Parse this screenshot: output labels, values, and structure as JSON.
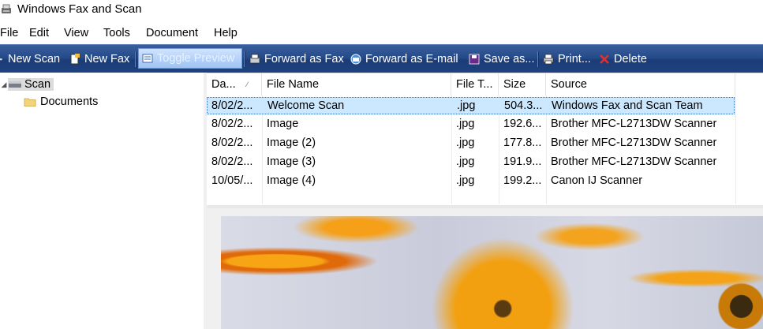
{
  "window": {
    "title": "Windows Fax and Scan"
  },
  "menu": [
    "File",
    "Edit",
    "View",
    "Tools",
    "Document",
    "Help"
  ],
  "toolbar": {
    "new_scan": "New Scan",
    "new_fax": "New Fax",
    "toggle_preview": "Toggle Preview",
    "forward_fax": "Forward as Fax",
    "forward_email": "Forward as E-mail",
    "save_as": "Save as...",
    "print": "Print...",
    "delete": "Delete"
  },
  "tree": {
    "root": "Scan",
    "child": "Documents"
  },
  "list": {
    "columns": [
      "Da...",
      "File Name",
      "File T...",
      "Size",
      "Source"
    ],
    "rows": [
      {
        "date": "8/02/2...",
        "name": "Welcome Scan",
        "type": ".jpg",
        "size": "504.3...",
        "source": "Windows Fax and Scan Team"
      },
      {
        "date": "8/02/2...",
        "name": "Image",
        "type": ".jpg",
        "size": "192.6...",
        "source": "Brother MFC-L2713DW Scanner"
      },
      {
        "date": "8/02/2...",
        "name": "Image (2)",
        "type": ".jpg",
        "size": "177.8...",
        "source": "Brother MFC-L2713DW Scanner"
      },
      {
        "date": "8/02/2...",
        "name": "Image (3)",
        "type": ".jpg",
        "size": "191.9...",
        "source": "Brother MFC-L2713DW Scanner"
      },
      {
        "date": "10/05/...",
        "name": "Image (4)",
        "type": ".jpg",
        "size": "199.2...",
        "source": "Canon IJ Scanner"
      }
    ],
    "selected_index": 0
  },
  "colors": {
    "toolbar": "#244a88",
    "selection": "#cce8ff"
  }
}
